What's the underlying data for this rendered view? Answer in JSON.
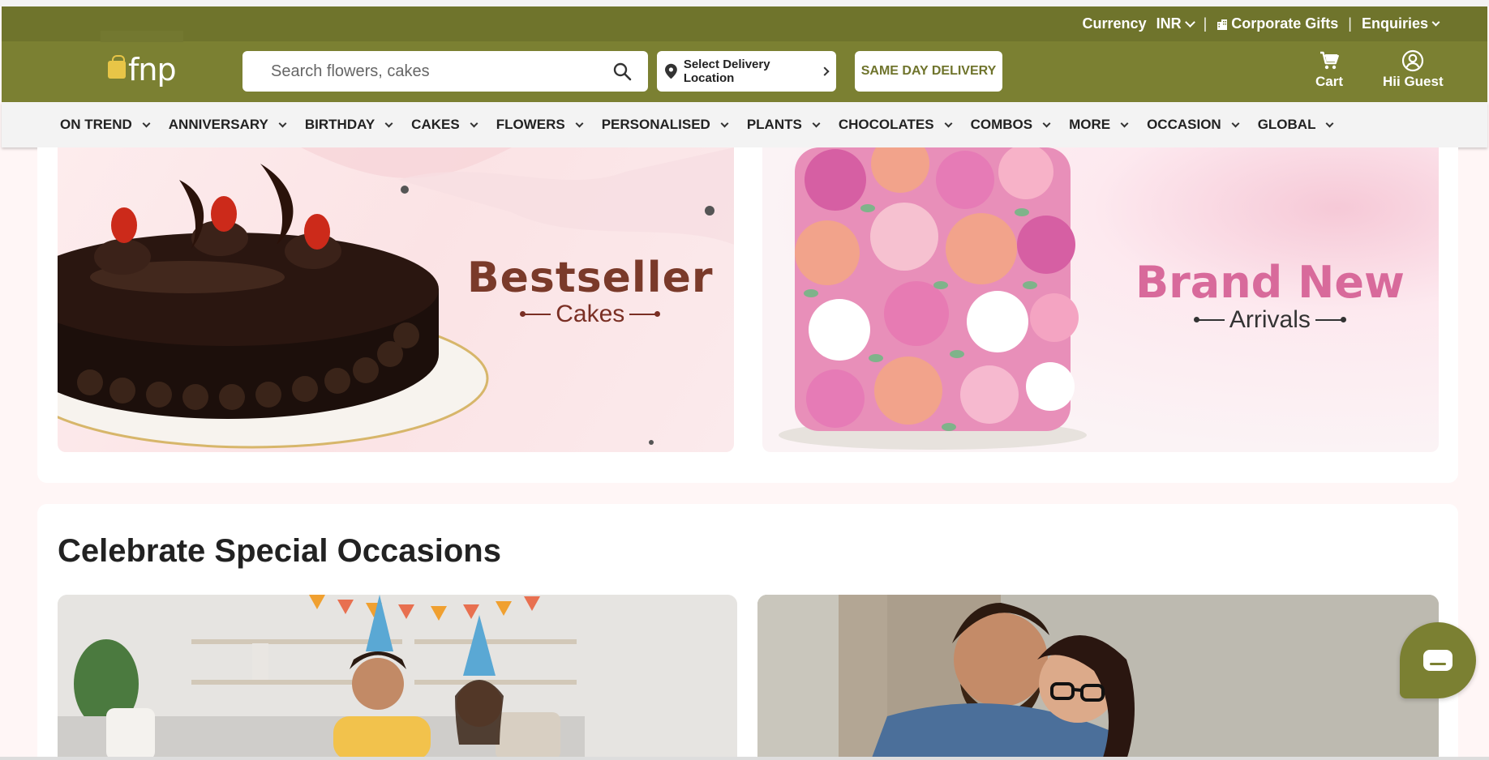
{
  "topbar": {
    "currency_label": "Currency",
    "currency_value": "INR",
    "separator": "|",
    "corporate_gifts": "Corporate Gifts",
    "enquiries": "Enquiries"
  },
  "header": {
    "logo_text": "fnp",
    "search_placeholder": "Search flowers, cakes",
    "delivery_location": "Select Delivery Location",
    "same_day": "SAME DAY DELIVERY",
    "cart_label": "Cart",
    "guest_label": "Hii Guest"
  },
  "nav": {
    "items": [
      "ON TREND",
      "ANNIVERSARY",
      "BIRTHDAY",
      "CAKES",
      "FLOWERS",
      "PERSONALISED",
      "PLANTS",
      "CHOCOLATES",
      "COMBOS",
      "MORE",
      "OCCASION",
      "GLOBAL"
    ]
  },
  "banners": {
    "left": {
      "title": "Bestseller",
      "subtitle": "Cakes"
    },
    "right": {
      "title": "Brand New",
      "subtitle": "Arrivals"
    }
  },
  "occasions": {
    "title": "Celebrate Special Occasions"
  },
  "colors": {
    "brand_olive": "#7b8032",
    "topbar_olive": "#6f742c",
    "page_bg": "#fff6f6"
  }
}
